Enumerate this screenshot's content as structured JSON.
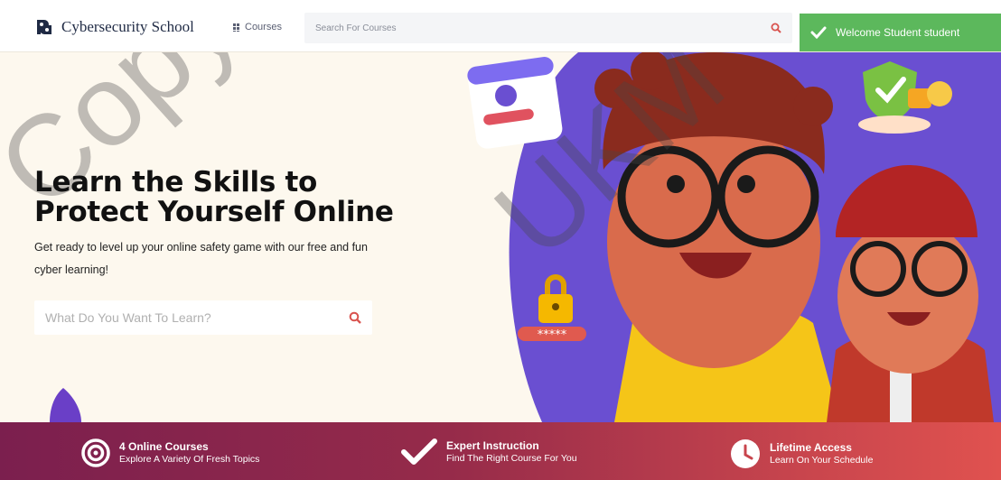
{
  "header": {
    "brand_name": "Cybersecurity School",
    "courses_label": "Courses",
    "search_placeholder": "Search For Courses"
  },
  "toast": {
    "message": "Welcome Student student"
  },
  "hero": {
    "title_line1": "Learn the Skills to",
    "title_line2": "Protect Yourself Online",
    "subtitle": "Get ready to level up your online safety game with our free and fun cyber learning!",
    "search_placeholder": "What Do You Want To Learn?",
    "password_mask": "*****"
  },
  "watermark": {
    "text_left": "Copyright",
    "text_right": "UKM"
  },
  "features": [
    {
      "icon": "target-icon",
      "title": "4 Online Courses",
      "desc": "Explore A Variety Of Fresh Topics"
    },
    {
      "icon": "check-icon",
      "title": "Expert Instruction",
      "desc": "Find The Right Course For You"
    },
    {
      "icon": "clock-icon",
      "title": "Lifetime Access",
      "desc": "Learn On Your Schedule"
    }
  ],
  "colors": {
    "accent_red": "#d9534f",
    "toast_green": "#5cb85c",
    "hero_purple": "#6a4fd1",
    "band_start": "#7b1f4e",
    "band_end": "#e0524f"
  }
}
